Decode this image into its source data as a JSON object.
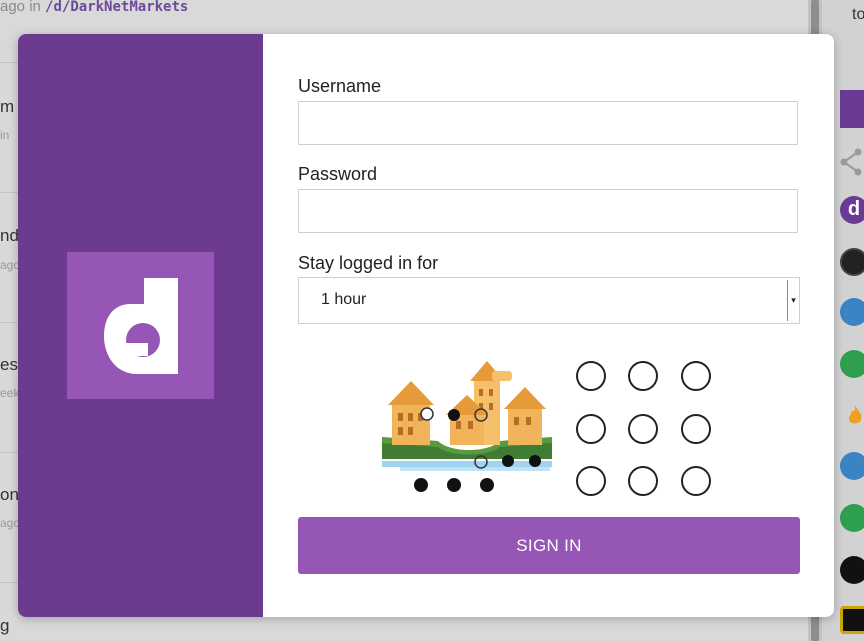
{
  "background": {
    "top_line_prefix": "ago in",
    "top_line_subdread": "/d/DarkNetMarkets",
    "snippets": [
      "m",
      "in",
      "nd",
      "ago",
      "es!",
      "eek",
      "on",
      "ago",
      "g"
    ],
    "sidebar_text": "to",
    "sidebar_badge": "d"
  },
  "login": {
    "username_label": "Username",
    "username_value": "",
    "password_label": "Password",
    "password_value": "",
    "stay_label": "Stay logged in for",
    "stay_selected": "1 hour",
    "submit_label": "SIGN IN"
  },
  "colors": {
    "brand_dark": "#6c3a8e",
    "brand_accent": "#9656b5"
  }
}
